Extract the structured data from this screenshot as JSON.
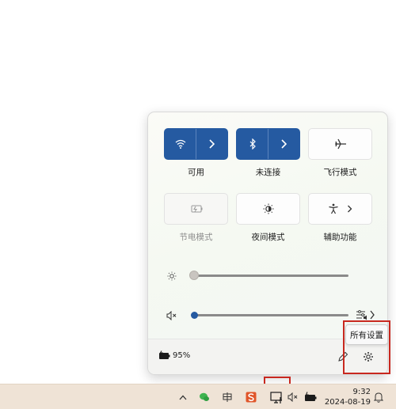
{
  "quick_settings": {
    "tiles": [
      {
        "label": "可用",
        "state": "on",
        "icon": "wifi-icon"
      },
      {
        "label": "未连接",
        "state": "on",
        "icon": "bluetooth-icon"
      },
      {
        "label": "飞行模式",
        "state": "off",
        "icon": "airplane-icon"
      },
      {
        "label": "节电模式",
        "state": "disabled",
        "icon": "battery-saver-icon"
      },
      {
        "label": "夜间模式",
        "state": "off",
        "icon": "night-light-icon"
      },
      {
        "label": "辅助功能",
        "state": "off",
        "icon": "accessibility-icon"
      }
    ],
    "brightness": {
      "level": 0.0,
      "icon": "brightness-icon"
    },
    "volume": {
      "level": 0.0,
      "icon": "volume-muted-icon",
      "output_icon": "audio-output-icon"
    },
    "battery_percent": "95%",
    "tooltip": "所有设置"
  },
  "taskbar": {
    "time": "9:32",
    "date": "2024-08-19"
  },
  "colors": {
    "accent": "#255aa1",
    "highlight_box": "#c8281f",
    "taskbar": "#efe3d6"
  }
}
